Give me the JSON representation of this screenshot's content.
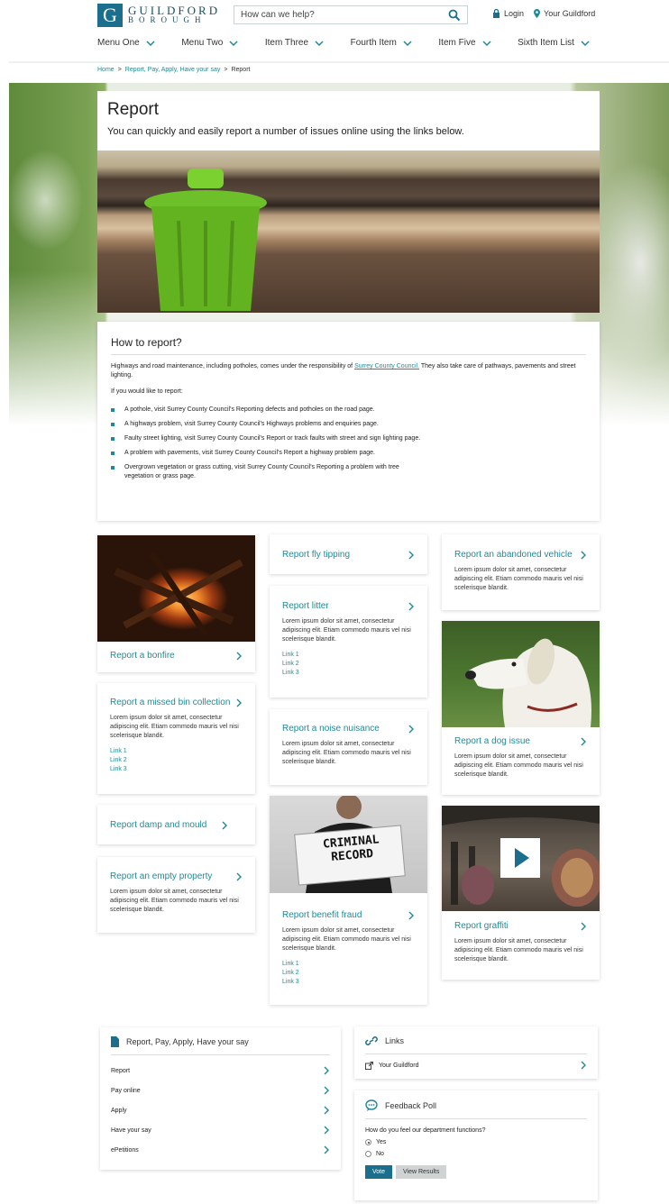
{
  "header": {
    "logo_line1": "GUILDFORD",
    "logo_line2": "BOROUGH",
    "search_placeholder": "How can we help?",
    "login": "Login",
    "your_guildford": "Your Guildford"
  },
  "nav": [
    {
      "label": "Menu One"
    },
    {
      "label": "Menu Two"
    },
    {
      "label": "Item Three"
    },
    {
      "label": "Fourth Item"
    },
    {
      "label": "Item Five"
    },
    {
      "label": "Sixth Item List"
    }
  ],
  "breadcrumb": {
    "home": "Home",
    "sep": ">",
    "section": "Report, Pay, Apply, Have your say",
    "current": "Report"
  },
  "page": {
    "title": "Report",
    "intro": "You can quickly and easily report a number of issues online using the links below."
  },
  "howto": {
    "heading": "How to report?",
    "para_before": "Highways and road maintenance, including potholes, comes under the responsibility of",
    "para_link": "Surrey County Council.",
    "para_after": "They also take care of pathways, pavements and street lighting.",
    "lead": "If you would like to report:",
    "items": [
      "A pothole, visit Surrey County Council's Reporting defects and potholes on the road page.",
      "A highways problem, visit Surrey County Council's Highways problems and enquiries page.",
      "Faulty street lighting, visit Surrey County Council's Report or track faults with street and sign lighting page.",
      "A problem with pavements, visit Surrey County Council's Report a highway problem page.",
      "Overgrown vegetation or grass cutting, visit Surrey County Council's Reporting a problem with tree vegetation or grass page."
    ]
  },
  "cards": {
    "lorem": "Lorem ipsum dolor sit amet, consectetur adipiscing elit. Etiam commodo mauris vel nisi scelerisque blandit.",
    "link1": "Link 1",
    "link2": "Link 2",
    "link3": "Link 3",
    "bonfire": "Report a bonfire",
    "missed_bin": "Report a missed bin collection",
    "damp": "Report damp and mould",
    "empty_property": "Report an empty property",
    "fly_tipping": "Report fly tipping",
    "litter": "Report litter",
    "noise": "Report a noise nuisance",
    "fraud": "Report benefit fraud",
    "fraud_sign_line1": "CRIMINAL",
    "fraud_sign_line2": "RECORD",
    "abandoned_vehicle": "Report an abandoned vehicle",
    "dog": "Report a dog issue",
    "graffiti": "Report graffiti"
  },
  "sidebar_panel": {
    "heading": "Report, Pay, Apply, Have your say",
    "items": [
      {
        "label": "Report"
      },
      {
        "label": "Pay online"
      },
      {
        "label": "Apply"
      },
      {
        "label": "Have your say"
      },
      {
        "label": "ePetitions"
      }
    ]
  },
  "links_panel": {
    "heading": "Links",
    "item": "Your Guildford"
  },
  "poll": {
    "heading": "Feedback Poll",
    "question": "How do you feel our department functions?",
    "option_yes": "Yes",
    "option_no": "No",
    "vote": "Vote",
    "view_results": "View Results"
  },
  "colors": {
    "accent": "#1f8a96",
    "brand": "#1b6f8c"
  }
}
